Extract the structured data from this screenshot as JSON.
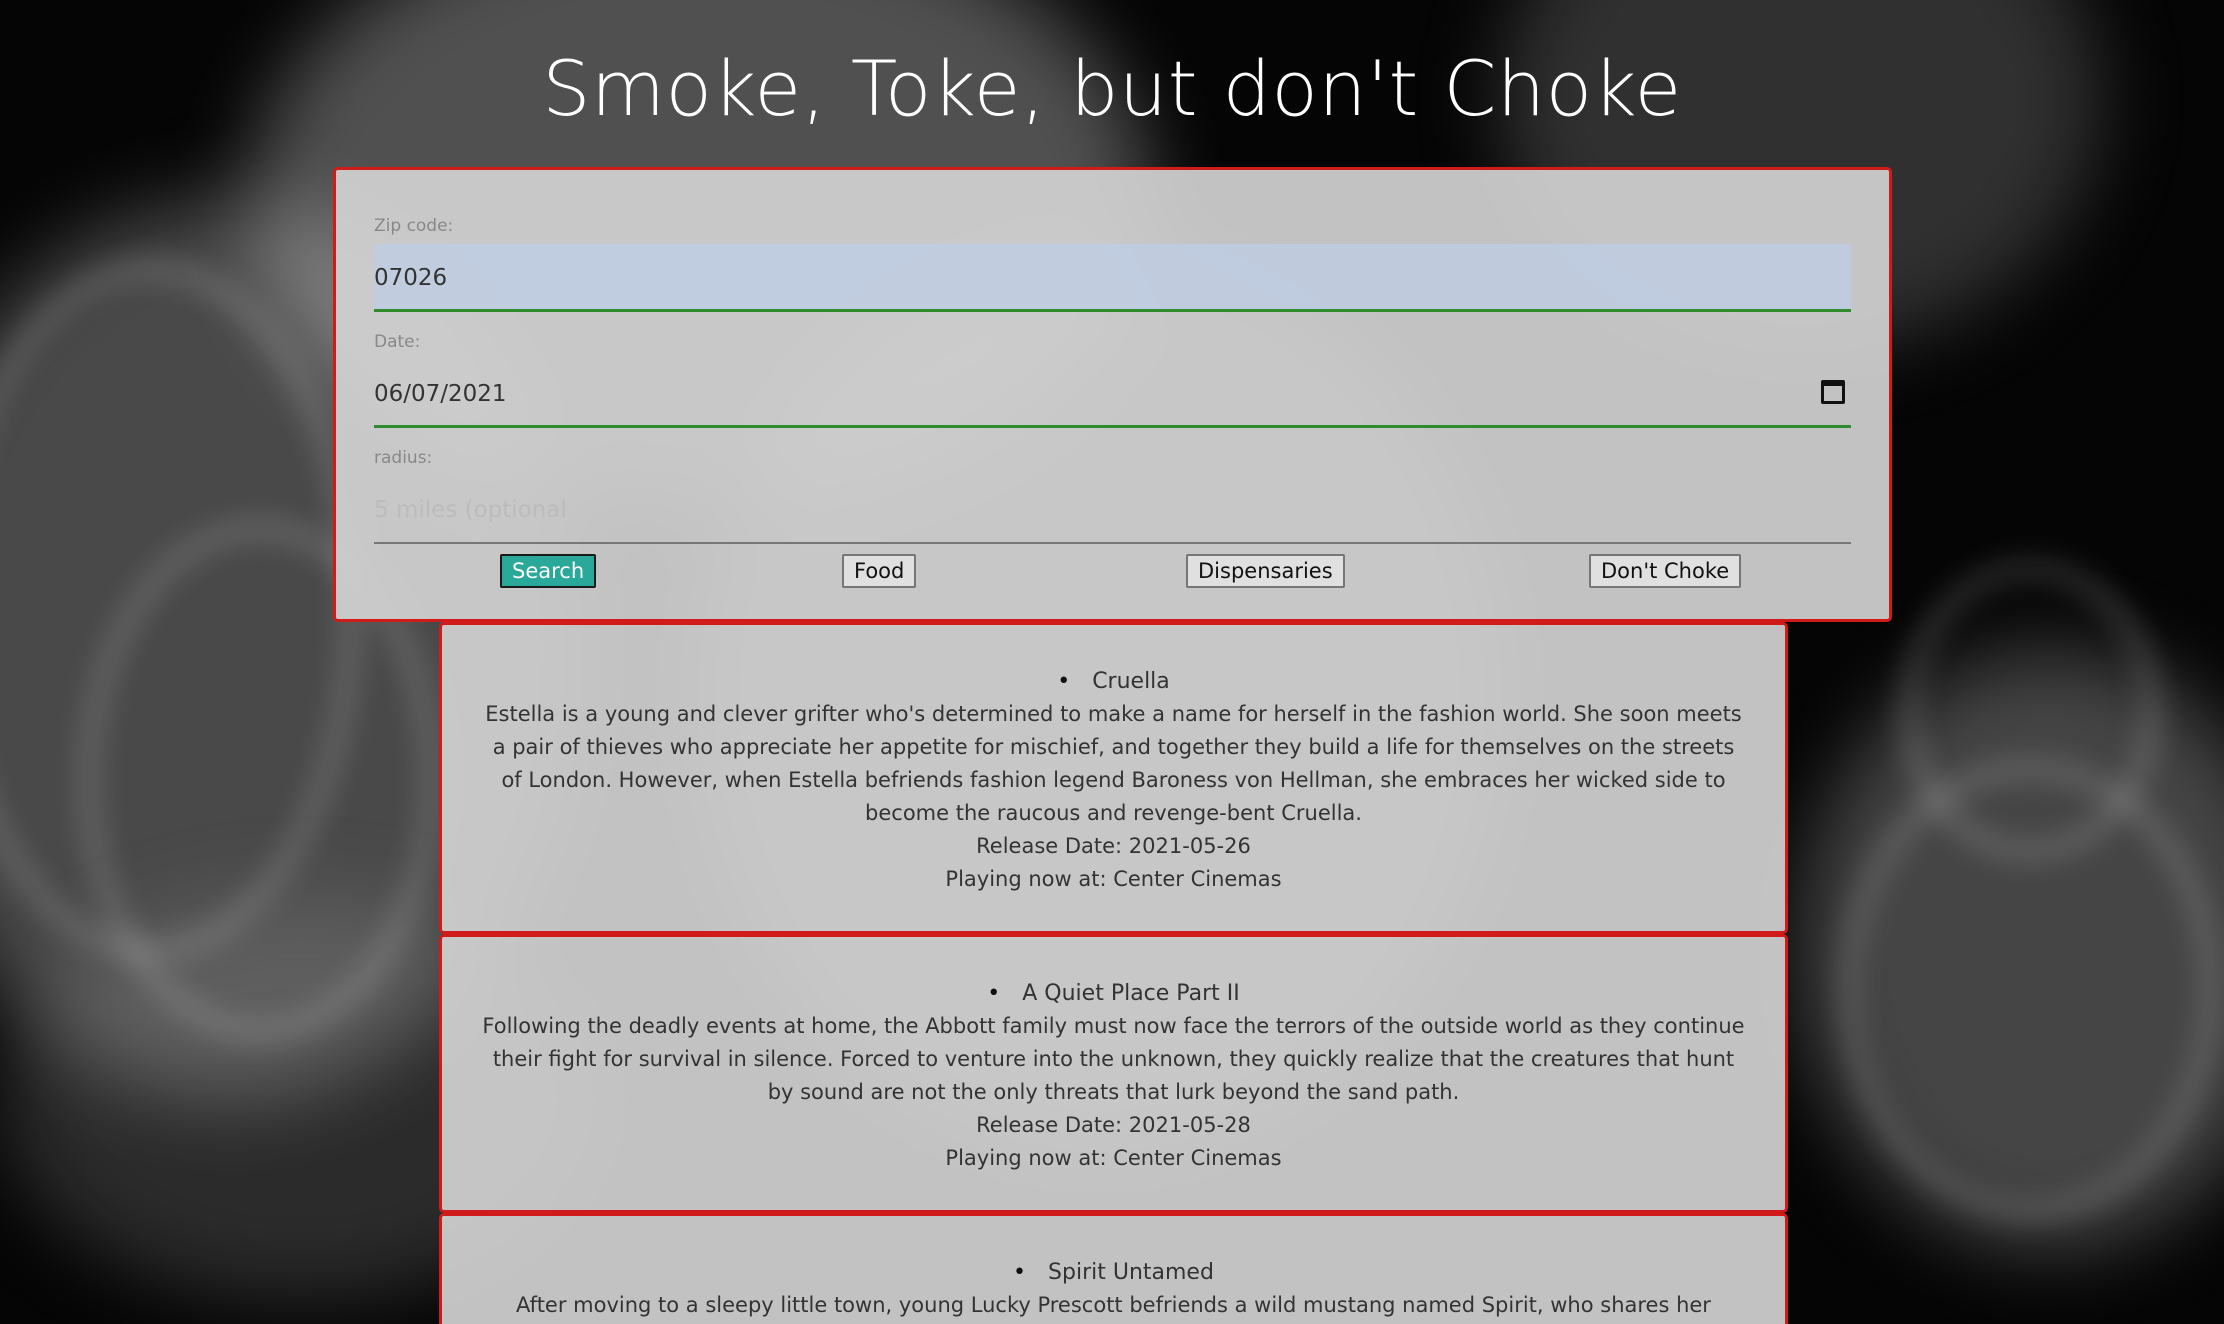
{
  "page": {
    "title": "Smoke, Toke, but don't Choke"
  },
  "form": {
    "zip_label": "Zip code:",
    "zip_value": "07026",
    "date_label": "Date:",
    "date_value": "06/07/2021",
    "radius_label": "radius:",
    "radius_placeholder": "5 miles (optional",
    "buttons": {
      "search": "Search",
      "food": "Food",
      "dispensaries": "Dispensaries",
      "dont_choke": "Don't Choke"
    }
  },
  "movies": [
    {
      "title": "Cruella",
      "description": "Estella is a young and clever grifter who's determined to make a name for herself in the fashion world. She soon meets a pair of thieves who appreciate her appetite for mischief, and together they build a life for themselves on the streets of London. However, when Estella befriends fashion legend Baroness von Hellman, she embraces her wicked side to become the raucous and revenge-bent Cruella.",
      "release": "Release Date: 2021-05-26",
      "playing": "Playing now at: Center Cinemas"
    },
    {
      "title": "A Quiet Place Part II",
      "description": "Following the deadly events at home, the Abbott family must now face the terrors of the outside world as they continue their fight for survival in silence. Forced to venture into the unknown, they quickly realize that the creatures that hunt by sound are not the only threats that lurk beyond the sand path.",
      "release": "Release Date: 2021-05-28",
      "playing": "Playing now at: Center Cinemas"
    },
    {
      "title": "Spirit Untamed",
      "description": "After moving to a sleepy little town, young Lucky Prescott befriends a wild mustang named Spirit, who shares her rebellious"
    }
  ],
  "colors": {
    "accent_border": "#d11b1b",
    "primary_button": "#2aa89a",
    "focus_underline": "#2e8b2e"
  }
}
